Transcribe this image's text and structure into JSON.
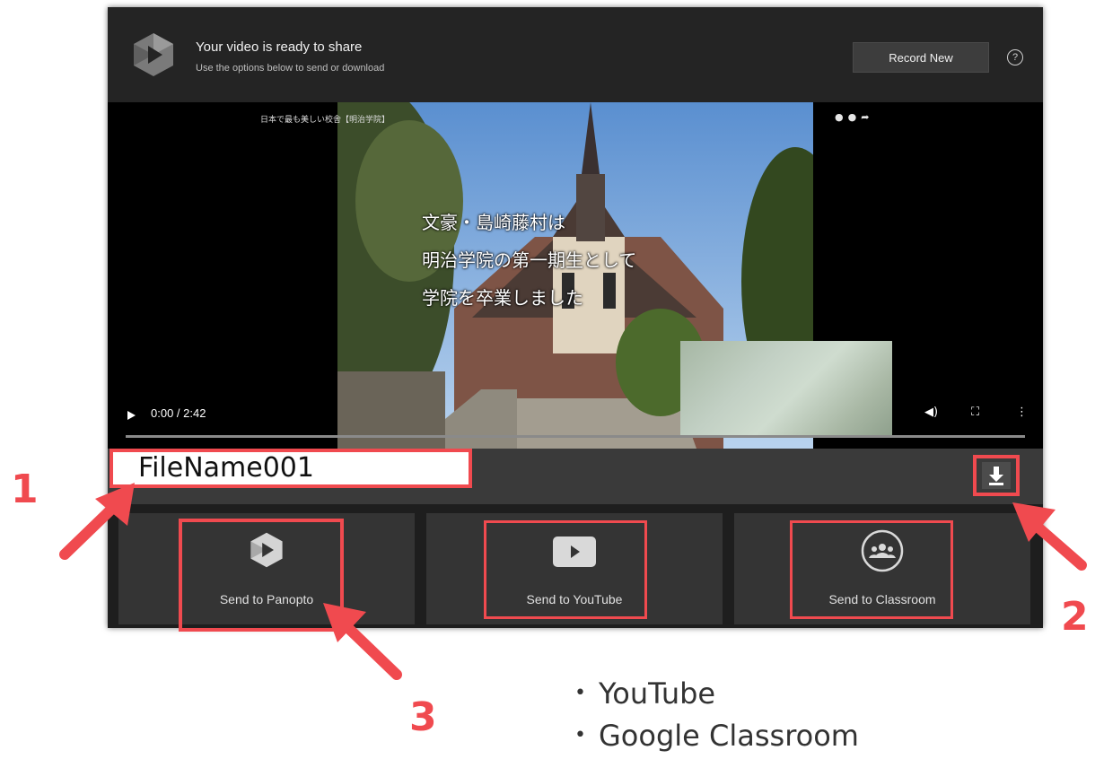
{
  "header": {
    "title": "Your video is ready to share",
    "subtitle": "Use the options below to send or download",
    "record_button": "Record New",
    "help_glyph": "?"
  },
  "video": {
    "overlay_title": "日本で最も美しい校舎【明治学院】",
    "subtitles": [
      "文豪・島崎藤村は",
      "明治学院の第一期生として",
      "学院を卒業しました"
    ],
    "time": "0:00 / 2:42",
    "progress": 0
  },
  "file": {
    "name": "FileName001"
  },
  "share_buttons": [
    {
      "label": "Send to Panopto",
      "icon": "panopto-logo-icon"
    },
    {
      "label": "Send to YouTube",
      "icon": "youtube-play-icon"
    },
    {
      "label": "Send to Classroom",
      "icon": "classroom-people-icon"
    }
  ],
  "annotations": [
    "1",
    "2",
    "3"
  ],
  "destinations": [
    "YouTube",
    "Google Classroom"
  ],
  "colors": {
    "highlight": "#f04a4f",
    "panel": "#242424",
    "tile": "#343434"
  }
}
